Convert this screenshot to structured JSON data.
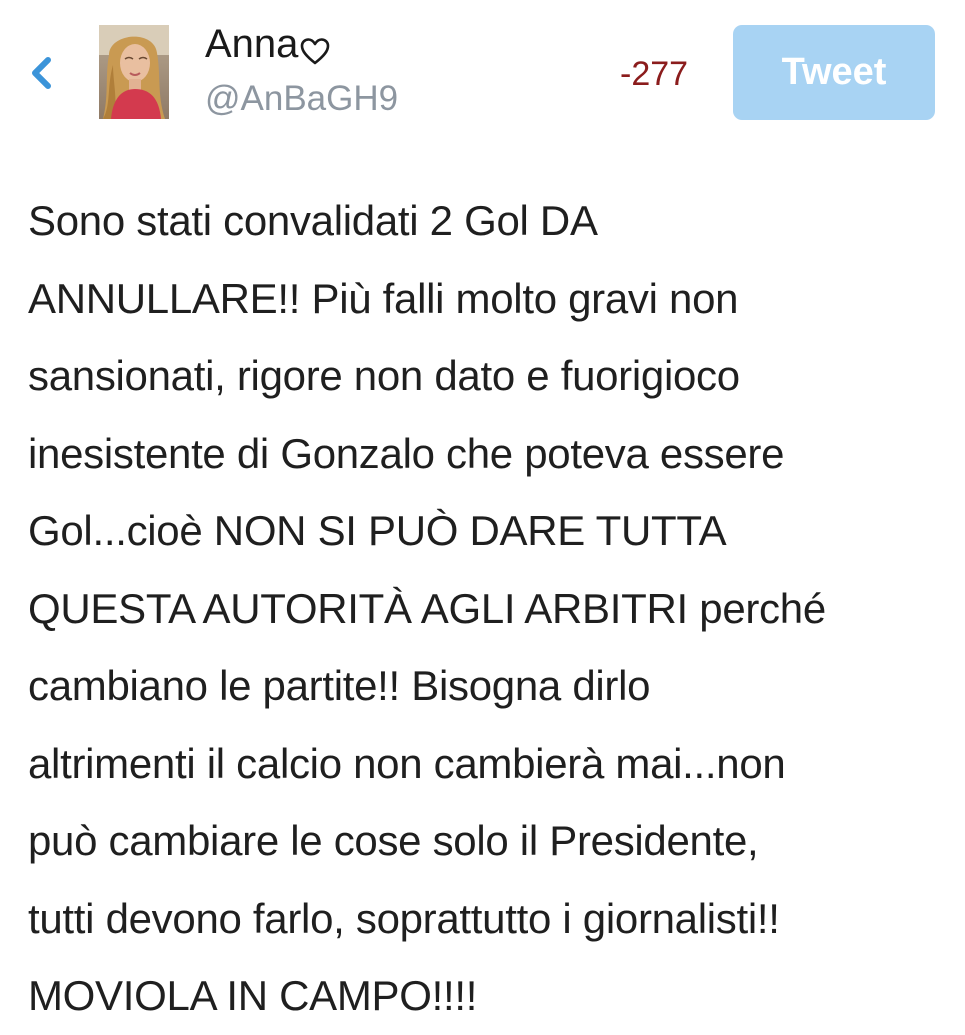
{
  "header": {
    "back_icon": "chevron-left-icon",
    "avatar_icon": "user-avatar-photo",
    "display_name": "Anna",
    "name_icon": "heart-outline-icon",
    "handle": "@AnBaGH9",
    "char_count": "-277",
    "tweet_label": "Tweet"
  },
  "compose": {
    "text": "Sono stati convalidati 2 Gol DA\nANNULLARE!! Più falli molto gravi non\nsansionati, rigore non dato e fuorigioco\ninesistente di Gonzalo che poteva essere\nGol...cioè NON SI PUÒ DARE TUTTA\nQUESTA AUTORITÀ AGLI ARBITRI perché\ncambiano le partite!! Bisogna dirlo\naltrimenti il calcio non cambierà mai...non\npuò cambiare le cose solo il Presidente,\ntutti devono farlo, soprattutto i giornalisti!!\nMOVIOLA IN CAMPO!!!!"
  },
  "colors": {
    "accent_blue": "#3b94d9",
    "tweet_button_disabled": "#a8d3f3",
    "char_count_over": "#8b1c1c",
    "handle_gray": "#8d96a0"
  }
}
